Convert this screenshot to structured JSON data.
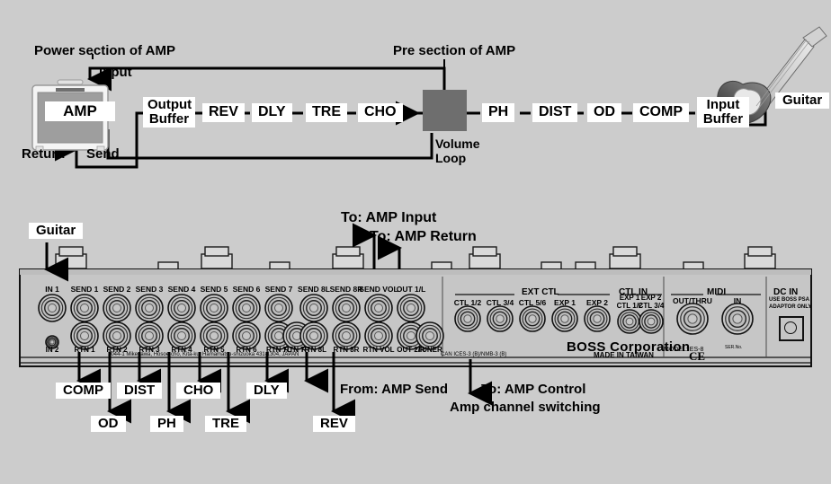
{
  "meta": {
    "background_color": "#cccccc",
    "accent_box_color": "#6e6e6e",
    "label_bg": "#ffffff",
    "line_color": "#000000"
  },
  "top_diagram": {
    "power_section_label": "Power section of AMP",
    "pre_section_label": "Pre section of AMP",
    "input_label": "Input",
    "return_label": "Return",
    "send_label": "Send",
    "amp_label": "AMP",
    "guitar_label": "Guitar",
    "volume_loop_label_line1": "Volume",
    "volume_loop_label_line2": "Loop",
    "output_buffer_line1": "Output",
    "output_buffer_line2": "Buffer",
    "input_buffer_line1": "Input",
    "input_buffer_line2": "Buffer",
    "chain_left_to_right": [
      "REV",
      "DLY",
      "TRE",
      "CHO"
    ],
    "chain_right_side": [
      "PH",
      "DIST",
      "OD",
      "COMP"
    ],
    "effects": {
      "rev": "REV",
      "dly": "DLY",
      "tre": "TRE",
      "cho": "CHO",
      "ph": "PH",
      "dist": "DIST",
      "od": "OD",
      "comp": "COMP"
    }
  },
  "device": {
    "brand_text": "BOSS Corporation",
    "made_in": "MADE IN TAIWAN",
    "model_text": "MODEL: ES-8",
    "address_text": "2044-1 Mikegawa, Hosoe-cho, Kita-ku, Hamamatsu-shizuoka 431-1304, JAPAN",
    "regulatory_text": "CAN ICES-3 (B)/NMB-3 (B)",
    "ser_no_label": "SER.No.",
    "ce_mark": "CE",
    "sections": {
      "ext_ctl": "EXT CTL",
      "ctl_in": "CTL IN",
      "midi": "MIDI",
      "dc_in": "DC IN",
      "dc_in_note_line1": "USE BOSS PSA",
      "dc_in_note_line2": "ADAPTOR ONLY"
    },
    "jacks_top_row": [
      "IN 1",
      "SEND 1",
      "SEND 2",
      "SEND 3",
      "SEND 4",
      "SEND 5",
      "SEND 6",
      "SEND 7",
      "SEND 8L",
      "SEND 8R",
      "SEND VOL",
      "OUT 1/L"
    ],
    "jacks_bottom_row": [
      "IN 2",
      "RTN 1",
      "RTN 2",
      "RTN 3",
      "RTN 4",
      "RTN 5",
      "RTN 6",
      "RTN 7L",
      "RTN 7R",
      "RTN 8L",
      "RTN 8R",
      "RTN VOL",
      "OUT 2/R",
      "TUNER"
    ],
    "ext_ctl_jacks": [
      "CTL 1/2",
      "CTL 3/4",
      "CTL 5/6",
      "EXP 1",
      "EXP 2"
    ],
    "ctl_in_jacks": [
      {
        "top": "EXP 1",
        "bottom": "CTL 1/2"
      },
      {
        "top": "EXP 2",
        "bottom": "CTL 3/4"
      }
    ],
    "midi_jacks": [
      "OUT/THRU",
      "IN"
    ]
  },
  "callouts": {
    "guitar_to_in1": "Guitar",
    "to_amp_input": "To: AMP Input",
    "to_amp_return": "To: AMP Return",
    "from_amp_send": "From: AMP Send",
    "to_amp_control": "To: AMP Control",
    "amp_channel_switching": "Amp channel switching",
    "row_upper": [
      "COMP",
      "DIST",
      "CHO",
      "DLY"
    ],
    "row_lower": [
      "OD",
      "PH",
      "TRE",
      "REV"
    ]
  }
}
